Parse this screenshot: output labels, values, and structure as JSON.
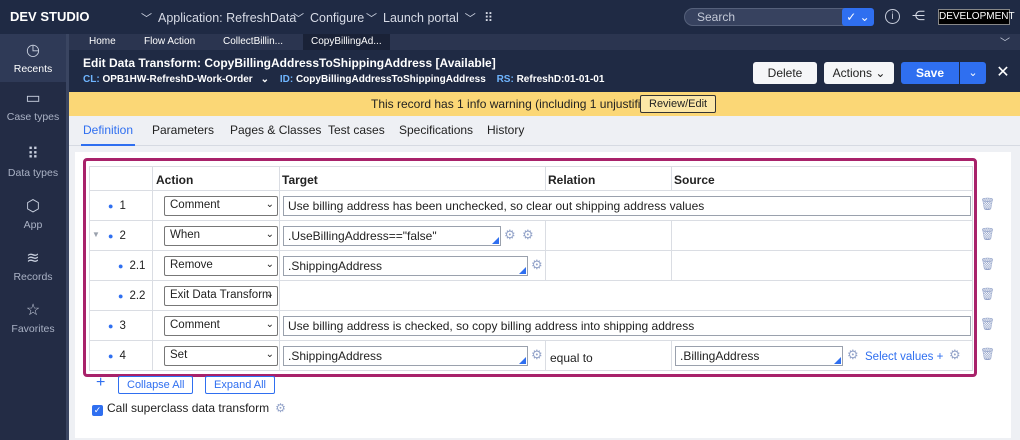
{
  "topbar": {
    "brand": "DEV STUDIO",
    "application_label": "Application: RefreshData",
    "configure_label": "Configure",
    "launch_label": "Launch portal",
    "search_placeholder": "Search",
    "environment_badge": "DEVELOPMENT"
  },
  "leftnav": {
    "items": [
      {
        "label": "Recents",
        "icon": "clock-icon"
      },
      {
        "label": "Case types",
        "icon": "case-icon"
      },
      {
        "label": "Data types",
        "icon": "grid-icon"
      },
      {
        "label": "App",
        "icon": "cube-icon"
      },
      {
        "label": "Records",
        "icon": "layers-icon"
      },
      {
        "label": "Favorites",
        "icon": "star-icon"
      }
    ]
  },
  "doctabs": [
    "Home",
    "Flow Action",
    "CollectBillin...",
    "CopyBillingAd..."
  ],
  "record": {
    "title": "Edit  Data Transform: CopyBillingAddressToShippingAddress [Available]",
    "cl_key": "CL:",
    "cl_value": "OPB1HW-RefreshD-Work-Order",
    "id_key": "ID:",
    "id_value": "CopyBillingAddressToShippingAddress",
    "rs_key": "RS:",
    "rs_value": "RefreshD:01-01-01",
    "delete_label": "Delete",
    "actions_label": "Actions",
    "save_label": "Save"
  },
  "warning": {
    "message": "This record has 1 info warning (including 1 unjustified)",
    "review_label": "Review/Edit"
  },
  "pagetabs": [
    "Definition",
    "Parameters",
    "Pages & Classes",
    "Test cases",
    "Specifications",
    "History"
  ],
  "table": {
    "headers": {
      "action": "Action",
      "target": "Target",
      "relation": "Relation",
      "source": "Source"
    },
    "rows": [
      {
        "step": "1",
        "action": "Comment",
        "target": "Use billing address has been unchecked, so clear out shipping address values",
        "relation": "",
        "source": ""
      },
      {
        "step": "2",
        "action": "When",
        "target": ".UseBillingAddress==\"false\"",
        "relation": "",
        "source": ""
      },
      {
        "step": "2.1",
        "action": "Remove",
        "target": ".ShippingAddress",
        "relation": "",
        "source": ""
      },
      {
        "step": "2.2",
        "action": "Exit Data Transform",
        "target": "",
        "relation": "",
        "source": ""
      },
      {
        "step": "3",
        "action": "Comment",
        "target": "Use billing address is checked, so copy billing address into shipping address",
        "relation": "",
        "source": ""
      },
      {
        "step": "4",
        "action": "Set",
        "target": ".ShippingAddress",
        "relation": "equal to",
        "source": ".BillingAddress"
      }
    ],
    "select_values_label": "Select values"
  },
  "footer": {
    "collapse_label": "Collapse All",
    "expand_label": "Expand All",
    "superclass_label": "Call superclass data transform"
  },
  "colors": {
    "accent": "#2f6ff0",
    "highlight": "#a8226a",
    "warning": "#fbd776",
    "header": "#1f2a44"
  }
}
